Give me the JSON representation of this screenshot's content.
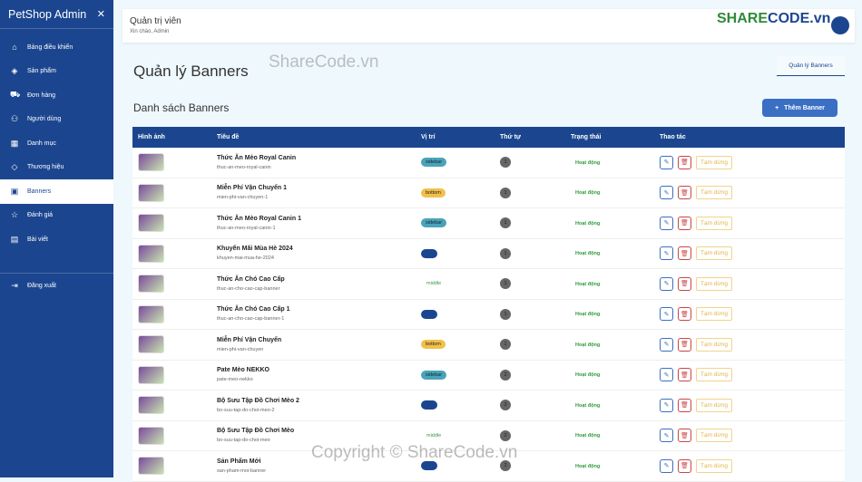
{
  "sidebar": {
    "brand": "PetShop Admin",
    "items": [
      {
        "label": "Bảng điều khiển",
        "icon": "home-icon"
      },
      {
        "label": "Sản phẩm",
        "icon": "box-icon"
      },
      {
        "label": "Đơn hàng",
        "icon": "cart-icon"
      },
      {
        "label": "Người dùng",
        "icon": "users-icon"
      },
      {
        "label": "Danh mục",
        "icon": "grid-icon"
      },
      {
        "label": "Thương hiệu",
        "icon": "tag-icon"
      },
      {
        "label": "Banners",
        "icon": "image-icon",
        "active": true
      },
      {
        "label": "Đánh giá",
        "icon": "star-icon"
      },
      {
        "label": "Bài viết",
        "icon": "document-icon"
      }
    ],
    "logout": "Đăng xuất"
  },
  "header": {
    "title": "Quản trị viên",
    "subtitle": "Xin chào, Admin"
  },
  "page": {
    "title": "Quản lý Banners",
    "breadcrumb": "Quản lý Banners",
    "list_title": "Danh sách Banners",
    "add_button": "Thêm Banner"
  },
  "table": {
    "columns": [
      "Hình ảnh",
      "Tiêu đề",
      "Vị trí",
      "Thứ tự",
      "Trạng thái",
      "Thao tác"
    ],
    "rows": [
      {
        "title": "Thức Ăn Mèo Royal Canin",
        "slug": "thuc-an-meo-royal-canin",
        "position": "sidebar",
        "order": "1",
        "status": "Hoạt động",
        "action": "Tạm dừng"
      },
      {
        "title": "Miễn Phí Vận Chuyển 1",
        "slug": "mien-phi-van-chuyen-1",
        "position": "bottom",
        "order": "1",
        "status": "Hoạt động",
        "action": "Tạm dừng"
      },
      {
        "title": "Thức Ăn Mèo Royal Canin 1",
        "slug": "thuc-an-meo-royal-canin-1",
        "position": "sidebar",
        "order": "1",
        "status": "Hoạt động",
        "action": "Tạm dừng"
      },
      {
        "title": "Khuyến Mãi Mùa Hè 2024",
        "slug": "khuyen-mai-mua-he-2024",
        "position": "top",
        "order": "1",
        "status": "Hoạt động",
        "action": "Tạm dừng"
      },
      {
        "title": "Thức Ăn Chó Cao Cấp",
        "slug": "thuc-an-cho-cao-cap-banner",
        "position": "middle",
        "order": "1",
        "status": "Hoạt động",
        "action": "Tạm dừng"
      },
      {
        "title": "Thức Ăn Chó Cao Cấp 1",
        "slug": "thuc-an-cho-cao-cap-banner-1",
        "position": "top",
        "order": "1",
        "status": "Hoạt động",
        "action": "Tạm dừng"
      },
      {
        "title": "Miễn Phí Vận Chuyển",
        "slug": "mien-phi-van-chuyen",
        "position": "bottom",
        "order": "1",
        "status": "Hoạt động",
        "action": "Tạm dừng"
      },
      {
        "title": "Pate Mèo NEKKO",
        "slug": "pate-meo-nekko",
        "position": "sidebar",
        "order": "2",
        "status": "Hoạt động",
        "action": "Tạm dừng"
      },
      {
        "title": "Bộ Sưu Tập Đồ Chơi Mèo 2",
        "slug": "bo-suu-tap-do-choi-meo-2",
        "position": "top",
        "order": "2",
        "status": "Hoạt động",
        "action": "Tạm dừng"
      },
      {
        "title": "Bộ Sưu Tập Đồ Chơi Mèo",
        "slug": "bo-suu-tap-do-choi-meo",
        "position": "middle",
        "order": "2",
        "status": "Hoạt động",
        "action": "Tạm dừng"
      },
      {
        "title": "Sản Phẩm Mới",
        "slug": "san-pham-moi-banner",
        "position": "top",
        "order": "2",
        "status": "Hoạt động",
        "action": "Tạm dừng"
      }
    ]
  },
  "watermark": "ShareCode.vn",
  "copyright": "Copyright © ShareCode.vn"
}
